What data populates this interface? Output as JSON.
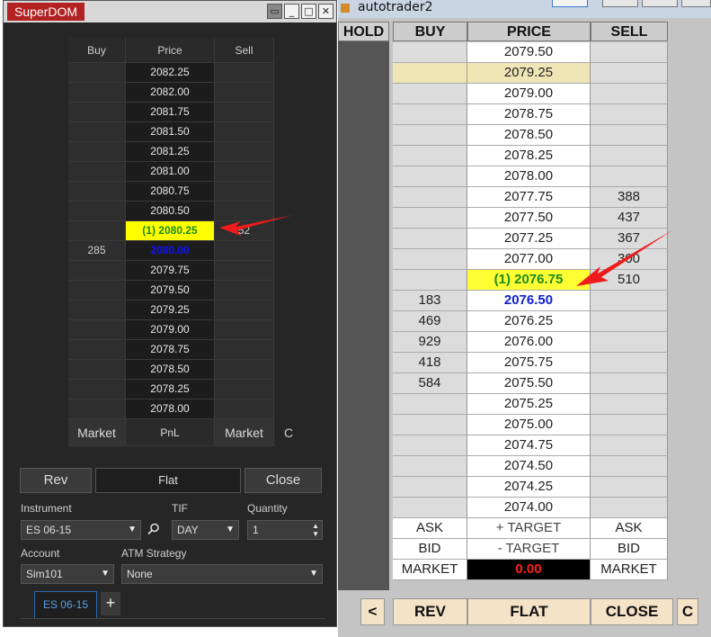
{
  "superdom": {
    "title": "SuperDOM",
    "window_buttons": [
      "▭",
      "▭",
      "□",
      "✕"
    ],
    "headers": {
      "buy": "Buy",
      "price": "Price",
      "sell": "Sell"
    },
    "rows": [
      {
        "buy": "",
        "price": "2082.25",
        "sell": ""
      },
      {
        "buy": "",
        "price": "2082.00",
        "sell": ""
      },
      {
        "buy": "",
        "price": "2081.75",
        "sell": ""
      },
      {
        "buy": "",
        "price": "2081.50",
        "sell": ""
      },
      {
        "buy": "",
        "price": "2081.25",
        "sell": ""
      },
      {
        "buy": "",
        "price": "2081.00",
        "sell": ""
      },
      {
        "buy": "",
        "price": "2080.75",
        "sell": ""
      },
      {
        "buy": "",
        "price": "2080.50",
        "sell": ""
      },
      {
        "buy": "",
        "price": "(1) 2080.25",
        "sell": "52",
        "style": "hl"
      },
      {
        "buy": "285",
        "price": "2080.00",
        "sell": "",
        "style": "blue"
      },
      {
        "buy": "",
        "price": "2079.75",
        "sell": ""
      },
      {
        "buy": "",
        "price": "2079.50",
        "sell": ""
      },
      {
        "buy": "",
        "price": "2079.25",
        "sell": ""
      },
      {
        "buy": "",
        "price": "2079.00",
        "sell": ""
      },
      {
        "buy": "",
        "price": "2078.75",
        "sell": ""
      },
      {
        "buy": "",
        "price": "2078.50",
        "sell": ""
      },
      {
        "buy": "",
        "price": "2078.25",
        "sell": ""
      },
      {
        "buy": "",
        "price": "2078.00",
        "sell": ""
      }
    ],
    "footer": {
      "buy": "Market",
      "price": "PnL",
      "sell": "Market",
      "extra": "C"
    },
    "buttons": {
      "rev": "Rev",
      "flat": "Flat",
      "close": "Close"
    },
    "instrument": {
      "label": "Instrument",
      "value": "ES 06-15"
    },
    "tif": {
      "label": "TIF",
      "value": "DAY"
    },
    "quantity": {
      "label": "Quantity",
      "value": "1"
    },
    "account": {
      "label": "Account",
      "value": "Sim101"
    },
    "atm": {
      "label": "ATM Strategy",
      "value": "None"
    },
    "tab": {
      "label": "ES 06-15",
      "add": "+"
    },
    "icons": {
      "search": "search-icon",
      "dropdown": "chevron-down-icon"
    }
  },
  "autotrader": {
    "title": "autotrader2",
    "headers": {
      "hold": "HOLD",
      "buy": "BUY",
      "price": "PRICE",
      "sell": "SELL"
    },
    "rows": [
      {
        "buy": "",
        "price": "2079.50",
        "sell": ""
      },
      {
        "buy": "",
        "price": "2079.25",
        "sell": "",
        "style": "tan"
      },
      {
        "buy": "",
        "price": "2079.00",
        "sell": ""
      },
      {
        "buy": "",
        "price": "2078.75",
        "sell": ""
      },
      {
        "buy": "",
        "price": "2078.50",
        "sell": ""
      },
      {
        "buy": "",
        "price": "2078.25",
        "sell": ""
      },
      {
        "buy": "",
        "price": "2078.00",
        "sell": ""
      },
      {
        "buy": "",
        "price": "2077.75",
        "sell": "388"
      },
      {
        "buy": "",
        "price": "2077.50",
        "sell": "437"
      },
      {
        "buy": "",
        "price": "2077.25",
        "sell": "367"
      },
      {
        "buy": "",
        "price": "2077.00",
        "sell": "300"
      },
      {
        "buy": "",
        "price": "(1) 2076.75",
        "sell": "510",
        "style": "hl"
      },
      {
        "buy": "183",
        "price": "2076.50",
        "sell": "",
        "style": "blue"
      },
      {
        "buy": "469",
        "price": "2076.25",
        "sell": ""
      },
      {
        "buy": "929",
        "price": "2076.00",
        "sell": ""
      },
      {
        "buy": "418",
        "price": "2075.75",
        "sell": ""
      },
      {
        "buy": "584",
        "price": "2075.50",
        "sell": ""
      },
      {
        "buy": "",
        "price": "2075.25",
        "sell": ""
      },
      {
        "buy": "",
        "price": "2075.00",
        "sell": ""
      },
      {
        "buy": "",
        "price": "2074.75",
        "sell": ""
      },
      {
        "buy": "",
        "price": "2074.50",
        "sell": ""
      },
      {
        "buy": "",
        "price": "2074.25",
        "sell": ""
      },
      {
        "buy": "",
        "price": "2074.00",
        "sell": ""
      },
      {
        "buy": "ASK",
        "price": "+ TARGET",
        "sell": "ASK",
        "style": "tgt"
      },
      {
        "buy": "BID",
        "price": "- TARGET",
        "sell": "BID",
        "style": "tgt"
      },
      {
        "buy": "MARKET",
        "price": "0.00",
        "sell": "MARKET",
        "style": "mkt"
      }
    ],
    "buttons": {
      "prev": "<",
      "rev": "REV",
      "flat": "FLAT",
      "close": "CLOSE",
      "c": "C"
    }
  },
  "colors": {
    "highlight": "#ffff00",
    "best_bid_price": "#1020d0",
    "pnl_text": "#ff2020",
    "annotation_arrow": "#ee1c1c"
  }
}
